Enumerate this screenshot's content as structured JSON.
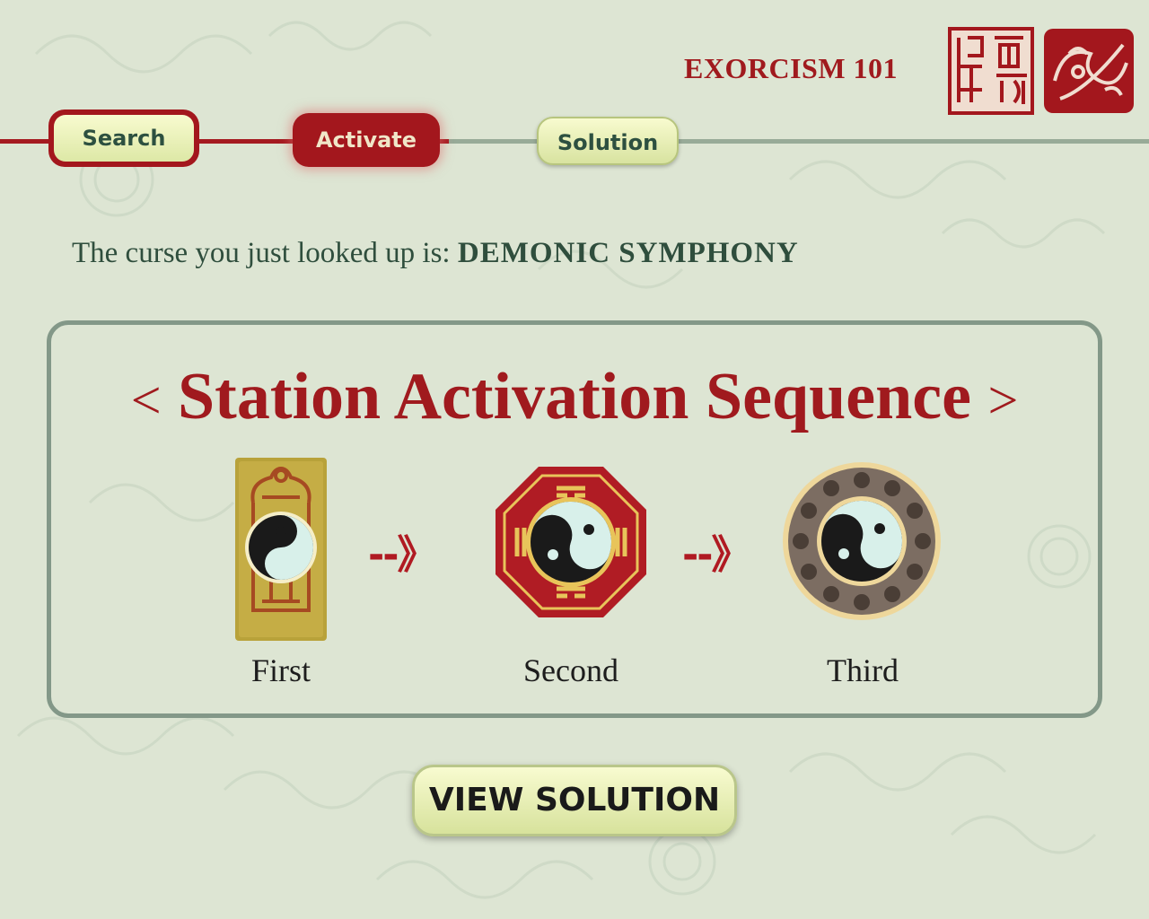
{
  "header": {
    "title": "EXORCISM 101"
  },
  "nav": {
    "tabs": [
      {
        "label": "Search"
      },
      {
        "label": "Activate"
      },
      {
        "label": "Solution"
      }
    ],
    "active_tab": "Activate"
  },
  "curse": {
    "prefix": "The curse you just looked up is:",
    "name": "DEMONIC SYMPHONY"
  },
  "panel": {
    "bracket_left": "<",
    "title": "Station Activation Sequence",
    "bracket_right": ">",
    "arrow_glyph": "--》",
    "stations": [
      {
        "label": "First",
        "icon": "gold-talisman-plaque-icon"
      },
      {
        "label": "Second",
        "icon": "bagua-octagon-icon"
      },
      {
        "label": "Third",
        "icon": "prayer-bead-disc-icon"
      }
    ]
  },
  "buttons": {
    "view_solution": "VIEW SOLUTION"
  },
  "colors": {
    "background": "#dde5d3",
    "accent_red": "#a01a1e",
    "dark_green_text": "#2f4e3d",
    "panel_border": "#839888",
    "button_gradient": "#f8fbd0"
  }
}
